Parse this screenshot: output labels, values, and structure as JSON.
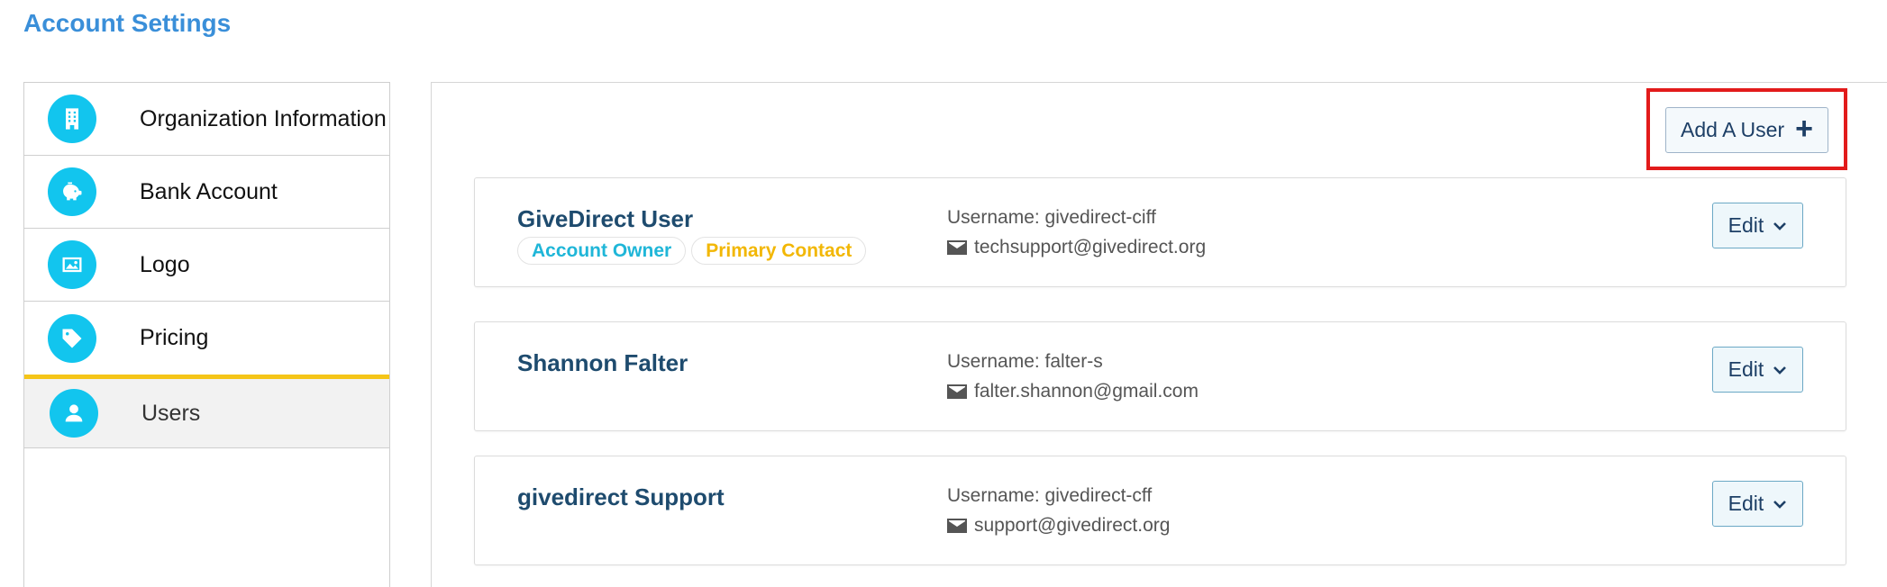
{
  "page": {
    "title": "Account Settings"
  },
  "sidebar": {
    "items": [
      {
        "label": "Organization Information",
        "icon": "building-icon",
        "active": false
      },
      {
        "label": "Bank Account",
        "icon": "piggy-bank-icon",
        "active": false
      },
      {
        "label": "Logo",
        "icon": "image-icon",
        "active": false
      },
      {
        "label": "Pricing",
        "icon": "tag-icon",
        "active": false
      },
      {
        "label": "Users",
        "icon": "user-icon",
        "active": true
      }
    ]
  },
  "toolbar": {
    "add_user_label": "Add A User",
    "add_user_icon": "plus-icon"
  },
  "users": [
    {
      "name": "GiveDirect User",
      "badges": [
        {
          "label": "Account Owner",
          "color": "#1fb6d8"
        },
        {
          "label": "Primary Contact",
          "color": "#f2b705"
        }
      ],
      "username": "Username: givedirect-ciff",
      "email": "techsupport@givedirect.org",
      "edit_label": "Edit"
    },
    {
      "name": "Shannon Falter",
      "badges": [],
      "username": "Username: falter-s",
      "email": "falter.shannon@gmail.com",
      "edit_label": "Edit"
    },
    {
      "name": "givedirect Support",
      "badges": [],
      "username": "Username: givedirect-cff",
      "email": "support@givedirect.org",
      "edit_label": "Edit"
    }
  ],
  "colors": {
    "accent": "#12c5ee",
    "title": "#3a8fd9",
    "active_indicator": "#f5c518",
    "highlight": "#e21b1b"
  }
}
